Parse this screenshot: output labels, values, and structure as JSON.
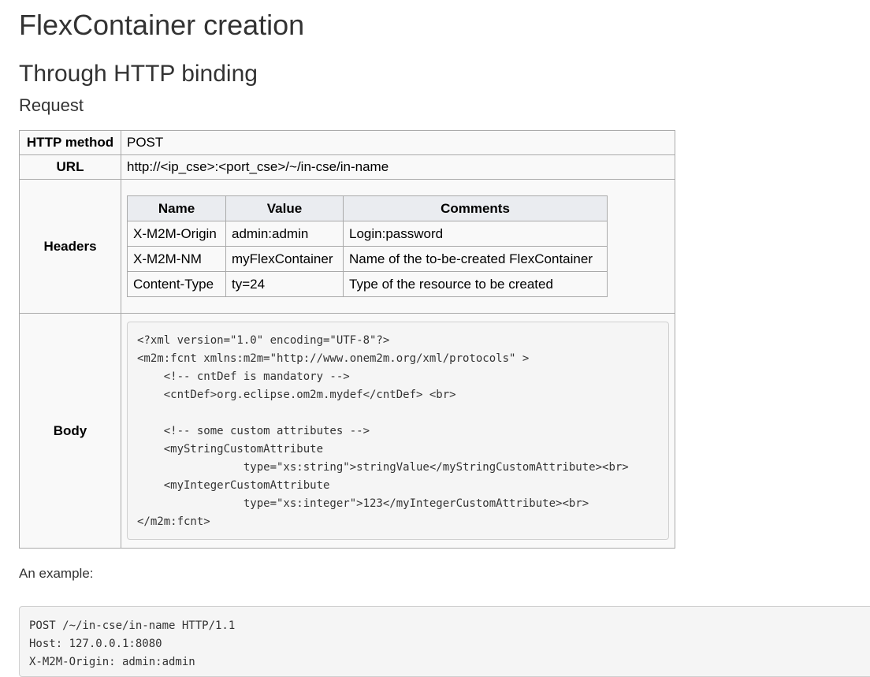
{
  "page": {
    "title": "FlexContainer creation",
    "subtitle": "Through HTTP binding",
    "section": "Request"
  },
  "request": {
    "method_label": "HTTP method",
    "method_value": "POST",
    "url_label": "URL",
    "url_value": "http://<ip_cse>:<port_cse>/~/in-cse/in-name",
    "headers_label": "Headers",
    "body_label": "Body",
    "headers_table": {
      "columns": [
        "Name",
        "Value",
        "Comments"
      ],
      "rows": [
        [
          "X-M2M-Origin",
          "admin:admin",
          "Login:password"
        ],
        [
          "X-M2M-NM",
          "myFlexContainer",
          "Name of the to-be-created FlexContainer"
        ],
        [
          "Content-Type",
          "ty=24",
          "Type of the resource to be created"
        ]
      ]
    },
    "body_code": "<?xml version=\"1.0\" encoding=\"UTF-8\"?>\n<m2m:fcnt xmlns:m2m=\"http://www.onem2m.org/xml/protocols\" >\n    <!-- cntDef is mandatory -->\n    <cntDef>org.eclipse.om2m.mydef</cntDef> <br>\n\n    <!-- some custom attributes -->\n    <myStringCustomAttribute\n                type=\"xs:string\">stringValue</myStringCustomAttribute><br>\n    <myIntegerCustomAttribute\n                type=\"xs:integer\">123</myIntegerCustomAttribute><br>\n</m2m:fcnt>"
  },
  "example": {
    "label": "An example:",
    "code": "POST /~/in-cse/in-name HTTP/1.1\nHost: 127.0.0.1:8080\nX-M2M-Origin: admin:admin"
  }
}
